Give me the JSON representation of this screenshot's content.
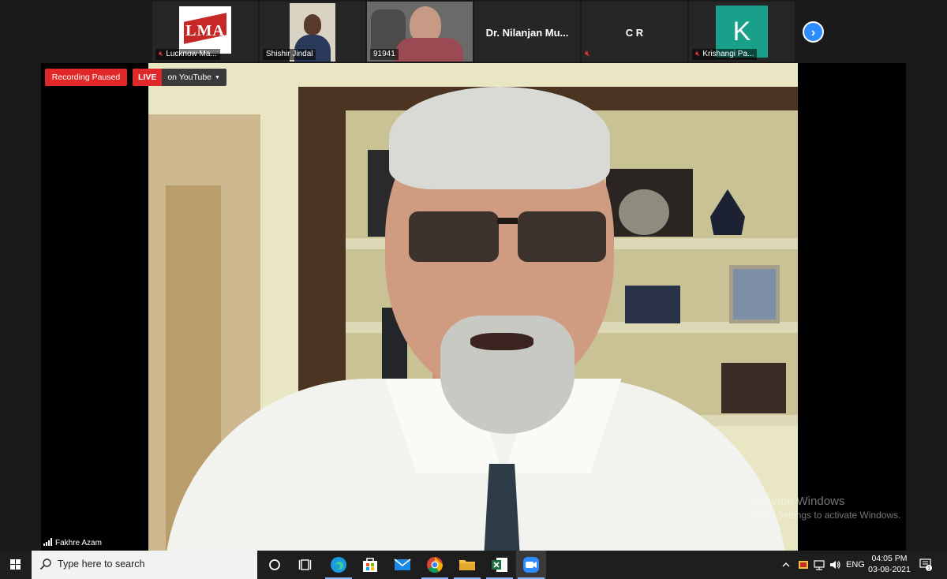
{
  "participants": [
    {
      "name": "Lucknow Ma...",
      "muted": true,
      "type": "logo",
      "logo_text": "LMA"
    },
    {
      "name": "Shishir Jindal",
      "muted": false,
      "type": "video"
    },
    {
      "name": "91941",
      "muted": false,
      "type": "video"
    },
    {
      "name": "Dr. Nilanjan Mu...",
      "muted": false,
      "type": "name-only"
    },
    {
      "name": "C R",
      "muted": true,
      "type": "name-only"
    },
    {
      "name": "Krishangi Pa...",
      "muted": true,
      "type": "avatar",
      "avatar_letter": "K",
      "avatar_color": "#18a08b"
    }
  ],
  "next_page_icon": "chevron-right-icon",
  "recording": {
    "status": "Recording Paused"
  },
  "live": {
    "tag": "LIVE",
    "destination": "on YouTube"
  },
  "active_speaker": {
    "name": "Fakhre Azam"
  },
  "watermark": {
    "line1": "Activate Windows",
    "line2": "Go to Settings to activate Windows."
  },
  "taskbar": {
    "search_placeholder": "Type here to search",
    "apps": [
      "cortana-icon",
      "task-view-icon",
      "edge-icon",
      "store-icon",
      "mail-icon",
      "chrome-icon",
      "file-explorer-icon",
      "excel-icon",
      "zoom-icon"
    ],
    "language": "ENG",
    "time": "04:05 PM",
    "date": "03-08-2021",
    "notification_count": "1"
  },
  "colors": {
    "accent_red": "#e02828",
    "zoom_blue": "#2d8cff",
    "avatar_teal": "#18a08b"
  }
}
